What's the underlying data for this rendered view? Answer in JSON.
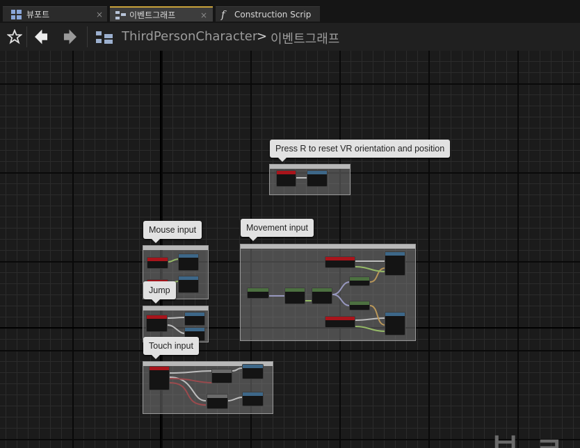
{
  "tabs": [
    {
      "label": "뷰포트",
      "icon": "viewport-grid-icon",
      "active": false
    },
    {
      "label": "이벤트그래프",
      "icon": "event-graph-icon",
      "active": true
    },
    {
      "label": "Construction Scrip",
      "icon": "function-icon",
      "active": false
    }
  ],
  "tab_close_glyph": "×",
  "breadcrumb": {
    "root": "ThirdPersonCharacter",
    "separator": ">",
    "current": "이벤트그래프"
  },
  "toolbar": {
    "icons": [
      "star-icon",
      "back-arrow-icon",
      "forward-arrow-icon",
      "blueprint-icon"
    ]
  },
  "comments": [
    {
      "id": "reset-vr",
      "bubble": "Press R to reset VR orientation and position"
    },
    {
      "id": "mouse",
      "bubble": "Mouse input"
    },
    {
      "id": "movement",
      "bubble": "Movement input"
    },
    {
      "id": "jump",
      "bubble": "Jump"
    },
    {
      "id": "touch",
      "bubble": "Touch input"
    }
  ],
  "watermark": "브 ㄹ",
  "colors": {
    "tab_active_accent": "#c9a23a",
    "event_node": "#a8141b",
    "function_node": "#3d6788",
    "input_axis_node": "#4c7040",
    "exec_wire": "#e8e8e8",
    "float_wire": "#9ee04a",
    "vector_wire": "#a0a0e8",
    "bool_wire": "#e0a030"
  }
}
